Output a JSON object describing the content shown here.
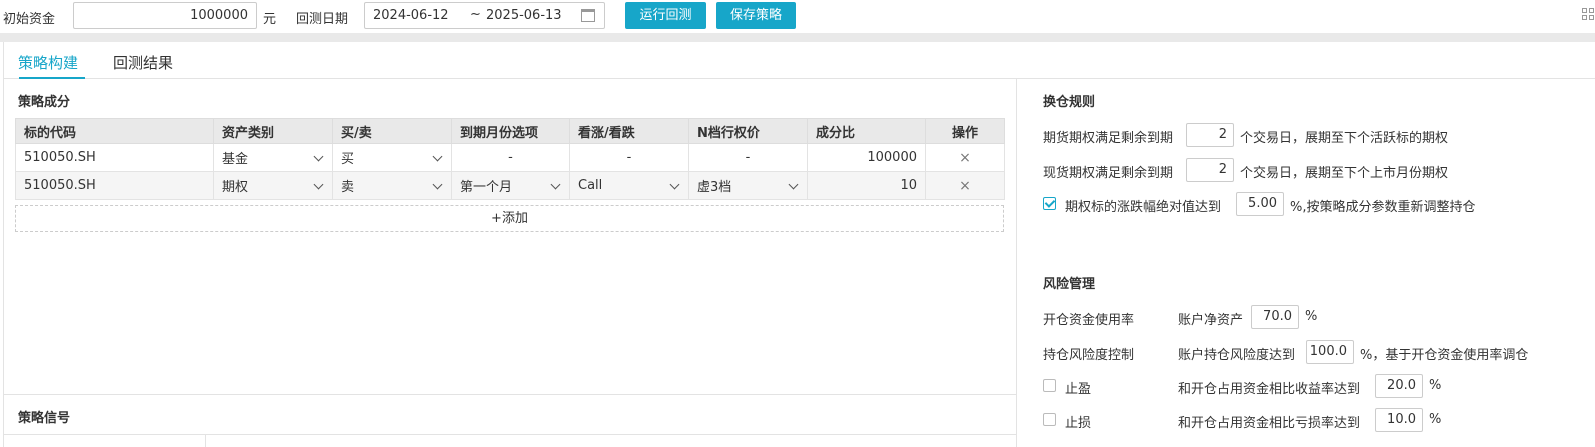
{
  "toolbar": {
    "capital_label": "初始资金",
    "capital_value": "1000000",
    "capital_unit": "元",
    "date_label": "回测日期",
    "date_start": "2024-06-12",
    "date_sep": "~",
    "date_end": "2025-06-13",
    "run_button": "运行回测",
    "save_button": "保存策略"
  },
  "tabs": [
    {
      "label": "策略构建",
      "active": true
    },
    {
      "label": "回测结果",
      "active": false
    }
  ],
  "composition": {
    "title": "策略成分",
    "headers": [
      "标的代码",
      "资产类别",
      "买/卖",
      "到期月份选项",
      "看涨/看跌",
      "N档行权价",
      "成分比",
      "操作"
    ],
    "rows": [
      {
        "code": "510050.SH",
        "asset": "基金",
        "side": "买",
        "expiry": "-",
        "callput": "-",
        "strike": "-",
        "ratio": "100000",
        "action": "×"
      },
      {
        "code": "510050.SH",
        "asset": "期权",
        "side": "卖",
        "expiry": "第一个月",
        "callput": "Call",
        "strike": "虚3档",
        "ratio": "10",
        "action": "×"
      }
    ],
    "add_label": "+添加"
  },
  "signal": {
    "title": "策略信号"
  },
  "rollover": {
    "title": "换仓规则",
    "rule1_prefix": "期货期权满足剩余到期",
    "rule1_value": "2",
    "rule1_suffix": "个交易日，展期至下个活跃标的期权",
    "rule2_prefix": "现货期权满足剩余到期",
    "rule2_value": "2",
    "rule2_suffix": "个交易日，展期至下个上市月份期权",
    "rule3_checked": true,
    "rule3_prefix": "期权标的涨跌幅绝对值达到",
    "rule3_value": "5.00",
    "rule3_suffix": "%,按策略成分参数重新调整持仓"
  },
  "risk": {
    "title": "风险管理",
    "open_label": "开仓资金使用率",
    "open_prefix": "账户净资产",
    "open_value": "70.0",
    "open_suffix": "%",
    "hold_label": "持仓风险度控制",
    "hold_prefix": "账户持仓风险度达到",
    "hold_value": "100.0",
    "hold_suffix": "%，基于开仓资金使用率调仓",
    "tp_checked": false,
    "tp_label": "止盈",
    "tp_prefix": "和开仓占用资金相比收益率达到",
    "tp_value": "20.0",
    "tp_suffix": "%",
    "sl_checked": false,
    "sl_label": "止损",
    "sl_prefix": "和开仓占用资金相比亏损率达到",
    "sl_value": "10.0",
    "sl_suffix": "%"
  },
  "colors": {
    "accent": "#17a6c9",
    "header_bg": "#e9e9e9"
  }
}
